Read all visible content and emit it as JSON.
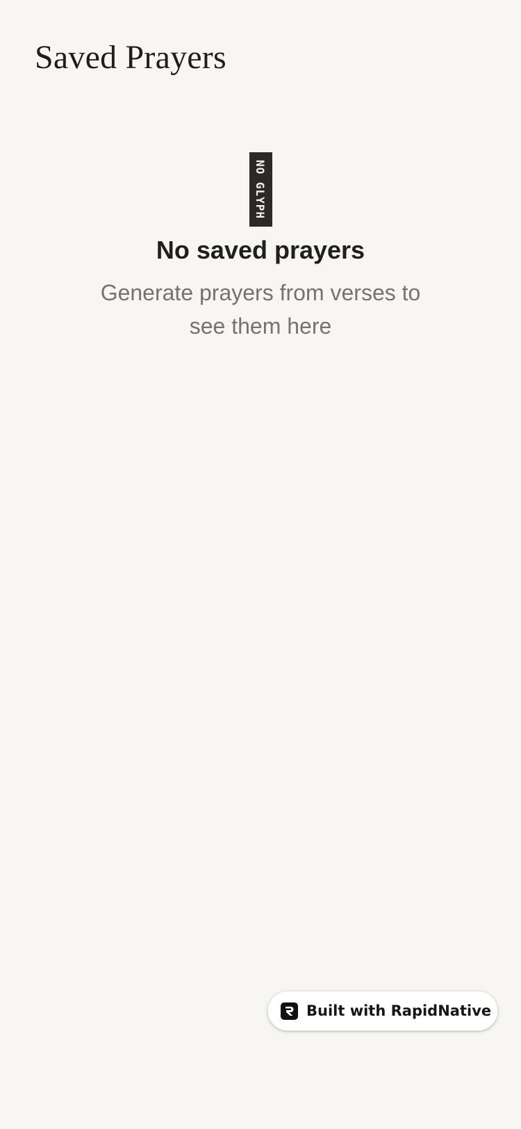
{
  "header": {
    "title": "Saved Prayers"
  },
  "empty_state": {
    "icon": "no-glyph-icon",
    "icon_text": "NO GLYPH",
    "title": "No saved prayers",
    "subtitle": "Generate prayers from verses to see them here"
  },
  "badge": {
    "icon": "rapidnative-logo-icon",
    "label": "Built with RapidNative"
  },
  "colors": {
    "background": "#f7f6f3",
    "title_text": "#1e1e1e",
    "subtitle_text": "#747370",
    "badge_background": "#ffffff"
  }
}
